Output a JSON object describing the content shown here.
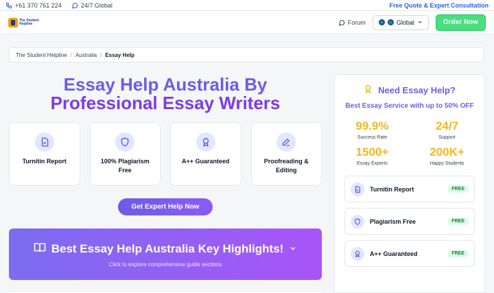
{
  "topbar": {
    "phone": "+61 370 761 224",
    "global_support": "24/7 Global",
    "quote_link": "Free Quote & Expert Consultation"
  },
  "header": {
    "logo_text_line1": "The Student",
    "logo_text_line2": "Helpline",
    "forum_label": "Forum",
    "region_label": "Global",
    "order_label": "Order Now"
  },
  "breadcrumb": {
    "items": [
      "The Student Helpline",
      "Australia",
      "Essay Help"
    ]
  },
  "hero": {
    "title_line1": "Essay Help Australia By",
    "title_line2": "Professional Essay Writers",
    "features": [
      {
        "label": "Turnitin Report",
        "icon": "document-check-icon"
      },
      {
        "label": "100% Plagiarism Free",
        "icon": "shield-icon"
      },
      {
        "label": "A++ Guaranteed",
        "icon": "award-icon"
      },
      {
        "label": "Proofreading & Editing",
        "icon": "pencil-icon"
      }
    ],
    "cta_label": "Get Expert Help Now"
  },
  "highlights": {
    "title": "Best Essay Help Australia Key Highlights!",
    "subtitle": "Click to explore comprehensive guide sections"
  },
  "sidebar": {
    "title": "Need Essay Help?",
    "subtitle": "Best Essay Service with up to 50% OFF",
    "stats": [
      {
        "value": "99.9%",
        "caption": "Success Rate"
      },
      {
        "value": "24/7",
        "caption": "Support"
      },
      {
        "value": "1500+",
        "caption": "Essay Experts"
      },
      {
        "value": "200K+",
        "caption": "Happy Students"
      }
    ],
    "perks": [
      {
        "label": "Turnitin Report",
        "badge": "FREE"
      },
      {
        "label": "Plagiarism Free",
        "badge": "FREE"
      },
      {
        "label": "A++ Guaranteed",
        "badge": "FREE"
      }
    ]
  },
  "colors": {
    "accent": "#6d5ce7",
    "stat": "#f5b81b",
    "order_button": "#4ade80"
  }
}
